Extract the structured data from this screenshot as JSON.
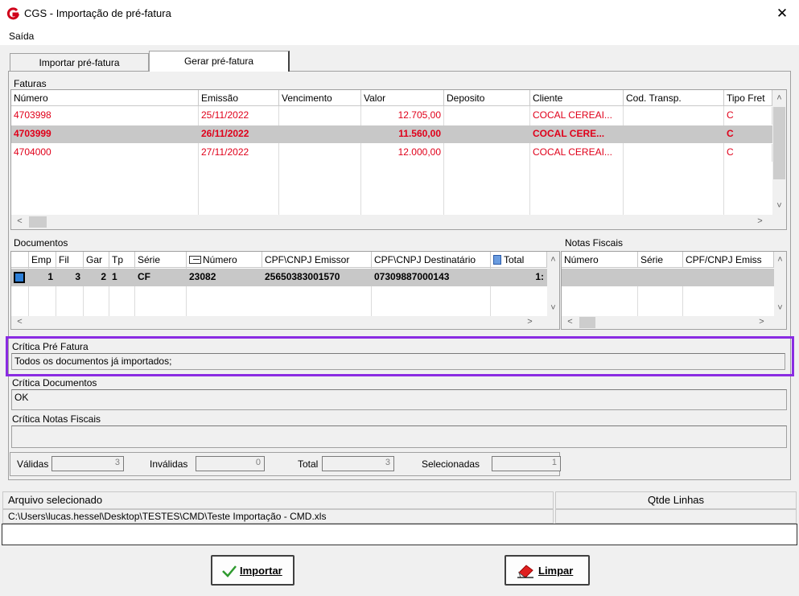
{
  "window": {
    "title": "CGS - Importação de pré-fatura",
    "close_glyph": "✕"
  },
  "menu": {
    "items": [
      "Saída"
    ]
  },
  "tabs": [
    {
      "label": "Importar pré-fatura",
      "active": false
    },
    {
      "label": "Gerar pré-fatura",
      "active": true
    }
  ],
  "faturas": {
    "label": "Faturas",
    "columns": [
      "Número",
      "Emissão",
      "Vencimento",
      "Valor",
      "Deposito",
      "Cliente",
      "Cod. Transp.",
      "Tipo Fret"
    ],
    "rows": [
      {
        "numero": "4703998",
        "emissao": "25/11/2022",
        "vencimento": "",
        "valor": "12.705,00",
        "deposito": "",
        "cliente": "COCAL CEREAI...",
        "cod_transp": "",
        "tipo_frete": "C",
        "selected": false
      },
      {
        "numero": "4703999",
        "emissao": "26/11/2022",
        "vencimento": "",
        "valor": "11.560,00",
        "deposito": "",
        "cliente": "COCAL CERE...",
        "cod_transp": "",
        "tipo_frete": "C",
        "selected": true
      },
      {
        "numero": "4704000",
        "emissao": "27/11/2022",
        "vencimento": "",
        "valor": "12.000,00",
        "deposito": "",
        "cliente": "COCAL CEREAI...",
        "cod_transp": "",
        "tipo_frete": "C",
        "selected": false
      }
    ]
  },
  "documentos": {
    "label": "Documentos",
    "columns": [
      "Emp",
      "Fil",
      "Gar",
      "Tp",
      "Série",
      "Número",
      "CPF\\CNPJ Emissor",
      "CPF\\CNPJ Destinatário",
      "Total"
    ],
    "rows": [
      {
        "emp": "1",
        "fil": "3",
        "gar": "2",
        "tp": "1",
        "serie": "CF",
        "numero": "23082",
        "cpf_emissor": "25650383001570",
        "cpf_destinatario": "07309887000143",
        "total": "1:"
      }
    ]
  },
  "notas_fiscais": {
    "label": "Notas Fiscais",
    "columns": [
      "Número",
      "Série",
      "CPF/CNPJ Emiss"
    ]
  },
  "criticas": {
    "pre_fatura": {
      "label": "Crítica Pré Fatura",
      "value": "Todos os documentos já importados;"
    },
    "documentos": {
      "label": "Crítica Documentos",
      "value": "OK"
    },
    "notas_fiscais": {
      "label": "Crítica Notas Fiscais",
      "value": ""
    }
  },
  "totais": {
    "validas_label": "Válidas",
    "validas": "3",
    "invalidas_label": "Inválidas",
    "invalidas": "0",
    "total_label": "Total",
    "total": "3",
    "selecionadas_label": "Selecionadas",
    "selecionadas": "1"
  },
  "status": {
    "arquivo_label": "Arquivo selecionado",
    "qtde_label": "Qtde Linhas",
    "arquivo_path": "C:\\Users\\lucas.hessel\\Desktop\\TESTES\\CMD\\Teste Importação - CMD.xls",
    "qtde_value": ""
  },
  "buttons": {
    "importar_label": "Importar",
    "limpar_label": "Limpar"
  },
  "colors": {
    "accent_highlight": "#8a2be2",
    "error_red": "#e0001a",
    "selected_row": "#c8c8c8"
  }
}
